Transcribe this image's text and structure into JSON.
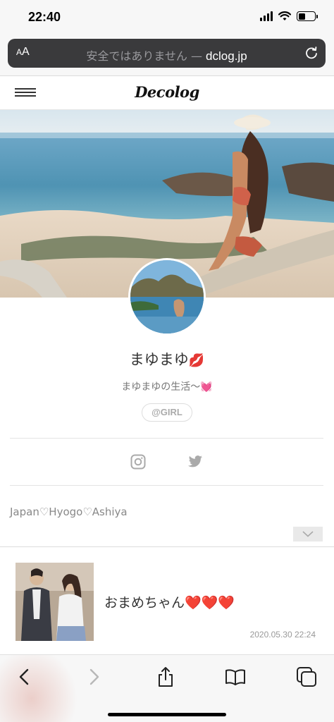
{
  "status_bar": {
    "time": "22:40"
  },
  "browser": {
    "aa_label_small": "A",
    "aa_label_large": "A",
    "url_insecure": "安全ではありません — ",
    "url_domain": "dclog.jp"
  },
  "site": {
    "logo": "Decolog"
  },
  "profile": {
    "name": "まゆまゆ",
    "name_emoji": "💋",
    "tagline": "まゆまゆの生活〜",
    "tagline_emoji": "💓",
    "badge": "@GIRL",
    "location": "Japan♡Hyogo♡Ashiya"
  },
  "article": {
    "title": "おまめちゃん",
    "title_emoji": "❤️❤️❤️",
    "date": "2020.05.30 22:24"
  },
  "colors": {
    "address_bar_bg": "#3a3a3c",
    "toolbar_bg": "#f7f7f7",
    "accent_pink": "#f05aa6",
    "heart_red": "#e8202d"
  },
  "icons": {
    "menu": "hamburger-icon",
    "reload": "reload-icon",
    "social": [
      "instagram-icon",
      "twitter-icon"
    ],
    "toolbar": [
      "back-icon",
      "forward-icon",
      "share-icon",
      "bookmarks-icon",
      "tabs-icon"
    ]
  }
}
